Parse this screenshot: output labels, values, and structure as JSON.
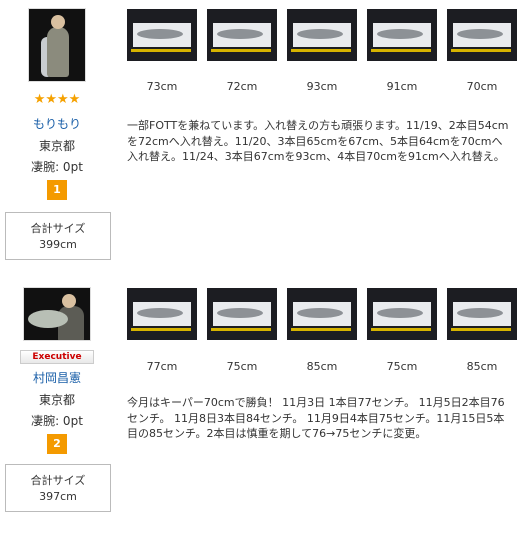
{
  "entries": [
    {
      "stars": "★★★★",
      "badge": "",
      "name": "もりもり",
      "prefecture": "東京都",
      "points": "凄腕: 0pt",
      "rank": "1",
      "total_label": "合計サイズ",
      "total_value": "399cm",
      "fish_lengths": [
        "73cm",
        "72cm",
        "93cm",
        "91cm",
        "70cm"
      ],
      "comment": "一部FOTTを兼ねています。入れ替えの方も頑張ります。11/19、2本目54cmを72cmへ入れ替え。11/20、3本目65cmを67cm、5本目64cmを70cmへ入れ替え。11/24、3本目67cmを93cm、4本目70cmを91cmへ入れ替え。"
    },
    {
      "stars": "",
      "badge": "Executive",
      "name": "村岡昌憲",
      "prefecture": "東京都",
      "points": "凄腕: 0pt",
      "rank": "2",
      "total_label": "合計サイズ",
      "total_value": "397cm",
      "fish_lengths": [
        "77cm",
        "75cm",
        "85cm",
        "75cm",
        "85cm"
      ],
      "comment": "今月はキーパー70cmで勝負！ 11月3日 1本目77センチ。 11月5日2本目76センチ。 11月8日3本目84センチ。 11月9日4本目75センチ。11月15日5本目の85センチ。2本目は慎重を期して76→75センチに変更。"
    }
  ],
  "colors": {
    "rank_bg": "#f49a00",
    "name_link": "#1a5fa8",
    "star": "#f5a100",
    "badge_text": "#cc0000"
  }
}
